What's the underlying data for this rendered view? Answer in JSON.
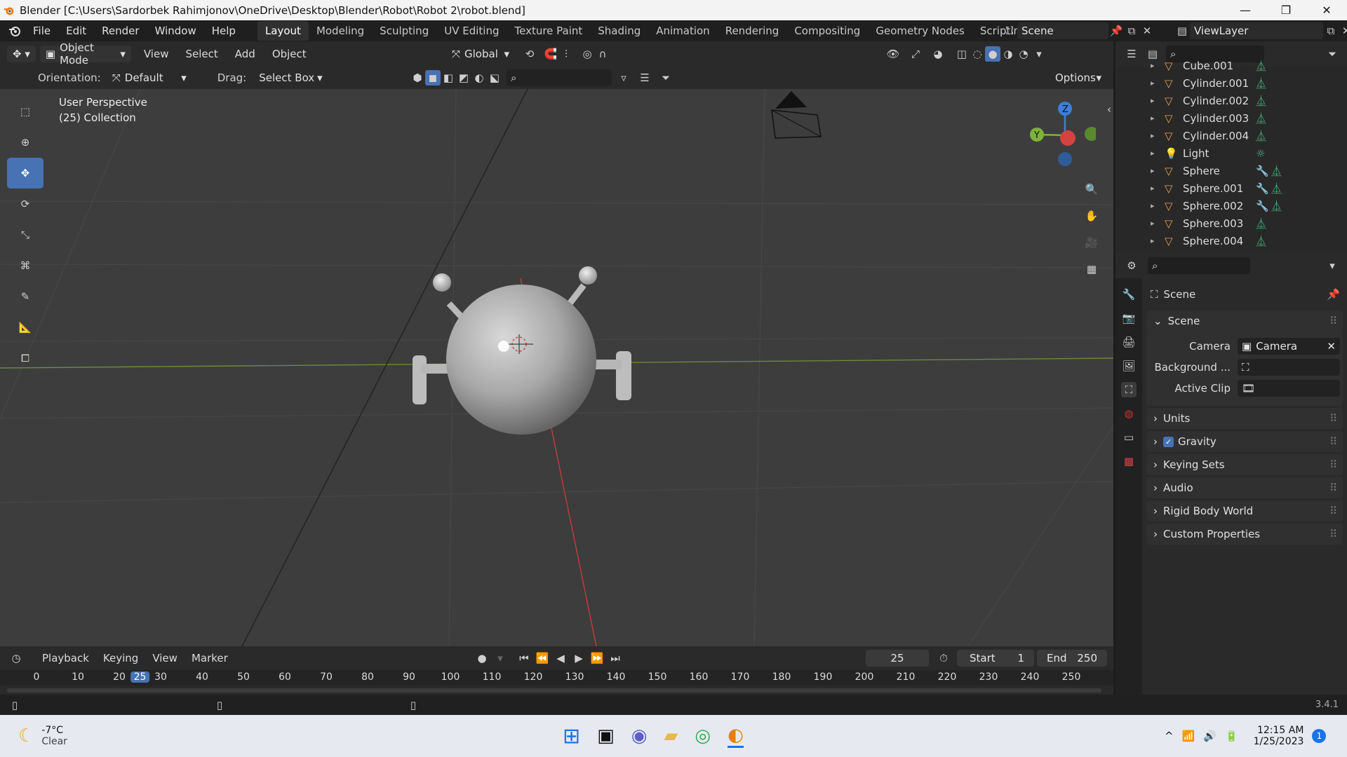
{
  "window": {
    "title": "Blender [C:\\Users\\Sardorbek Rahimjonov\\OneDrive\\Desktop\\Blender\\Robot\\Robot 2\\robot.blend]",
    "minimize": "—",
    "maximize": "❐",
    "close": "✕"
  },
  "menu": [
    "File",
    "Edit",
    "Render",
    "Window",
    "Help"
  ],
  "workspaces": [
    "Layout",
    "Modeling",
    "Sculpting",
    "UV Editing",
    "Texture Paint",
    "Shading",
    "Animation",
    "Rendering",
    "Compositing",
    "Geometry Nodes",
    "Scripting"
  ],
  "active_workspace": "Layout",
  "add_workspace": "+",
  "scene_field": "Scene",
  "viewlayer_field": "ViewLayer",
  "viewport_header": {
    "mode": "Object Mode",
    "menus": [
      "View",
      "Select",
      "Add",
      "Object"
    ],
    "transform": "Global",
    "orientation_label": "Orientation:",
    "orientation_value": "Default",
    "drag_label": "Drag:",
    "drag_value": "Select Box",
    "options": "Options"
  },
  "viewport": {
    "perspective": "User Perspective",
    "collection": "(25) Collection",
    "gizmo_z": "Z",
    "gizmo_y": "Y"
  },
  "outliner": {
    "items": [
      {
        "name": "Cube.001",
        "modifier": false
      },
      {
        "name": "Cylinder.001",
        "modifier": false
      },
      {
        "name": "Cylinder.002",
        "modifier": false
      },
      {
        "name": "Cylinder.003",
        "modifier": false
      },
      {
        "name": "Cylinder.004",
        "modifier": false
      },
      {
        "name": "Light",
        "modifier": false,
        "type": "light"
      },
      {
        "name": "Sphere",
        "modifier": true
      },
      {
        "name": "Sphere.001",
        "modifier": true
      },
      {
        "name": "Sphere.002",
        "modifier": true
      },
      {
        "name": "Sphere.003",
        "modifier": false
      },
      {
        "name": "Sphere.004",
        "modifier": false
      }
    ]
  },
  "properties": {
    "context": "Scene",
    "panel": "Scene",
    "camera_label": "Camera",
    "camera_value": "Camera",
    "background_label": "Background ...",
    "active_clip_label": "Active Clip",
    "sections": [
      "Units",
      "Gravity",
      "Keying Sets",
      "Audio",
      "Rigid Body World",
      "Custom Properties"
    ],
    "gravity_checked": true
  },
  "timeline": {
    "menus": [
      "Playback",
      "Keying",
      "View",
      "Marker"
    ],
    "current_frame": "25",
    "start_label": "Start",
    "start_value": "1",
    "end_label": "End",
    "end_value": "250",
    "ticks": [
      "0",
      "10",
      "20",
      "25",
      "30",
      "40",
      "50",
      "60",
      "70",
      "80",
      "90",
      "100",
      "110",
      "120",
      "130",
      "140",
      "150",
      "160",
      "170",
      "180",
      "190",
      "200",
      "210",
      "220",
      "230",
      "240",
      "250"
    ]
  },
  "status": {
    "version": "3.4.1"
  },
  "taskbar": {
    "weather_temp": "-7°C",
    "weather_desc": "Clear",
    "time": "12:15 AM",
    "date": "1/25/2023",
    "notification_count": "1"
  },
  "colors": {
    "accent_blue": "#4772b3",
    "x_axis": "#d4433f",
    "y_axis": "#7eb33a",
    "z_axis": "#3d7fd6",
    "object_orange": "#e8a04a"
  }
}
